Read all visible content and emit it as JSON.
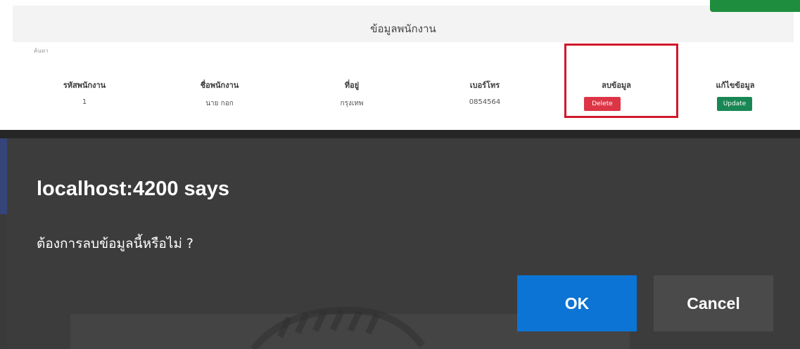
{
  "page": {
    "title": "ข้อมูลพนักงาน",
    "search_label": "ค้นหา",
    "table": {
      "headers": [
        "รหัสพนักงาน",
        "ชื่อพนักงาน",
        "ที่อยู่",
        "เบอร์โทร",
        "ลบข้อมูล",
        "แก้ไขข้อมูล"
      ],
      "rows": [
        {
          "id": "1",
          "name": "นาย กอก",
          "address": "กรุงเทพ",
          "phone": "0854564",
          "delete_label": "Delete",
          "update_label": "Update"
        }
      ]
    },
    "colors": {
      "highlight": "#d0182b",
      "delete_button": "#dc3545",
      "update_button": "#198754"
    }
  },
  "dialog": {
    "title": "localhost:4200 says",
    "message": "ต้องการลบข้อมูลนี้หรือไม่ ?",
    "ok_label": "OK",
    "cancel_label": "Cancel",
    "colors": {
      "background": "#3c3c3c",
      "ok_button": "#0b74d4",
      "cancel_button": "#4a4a4a"
    }
  }
}
